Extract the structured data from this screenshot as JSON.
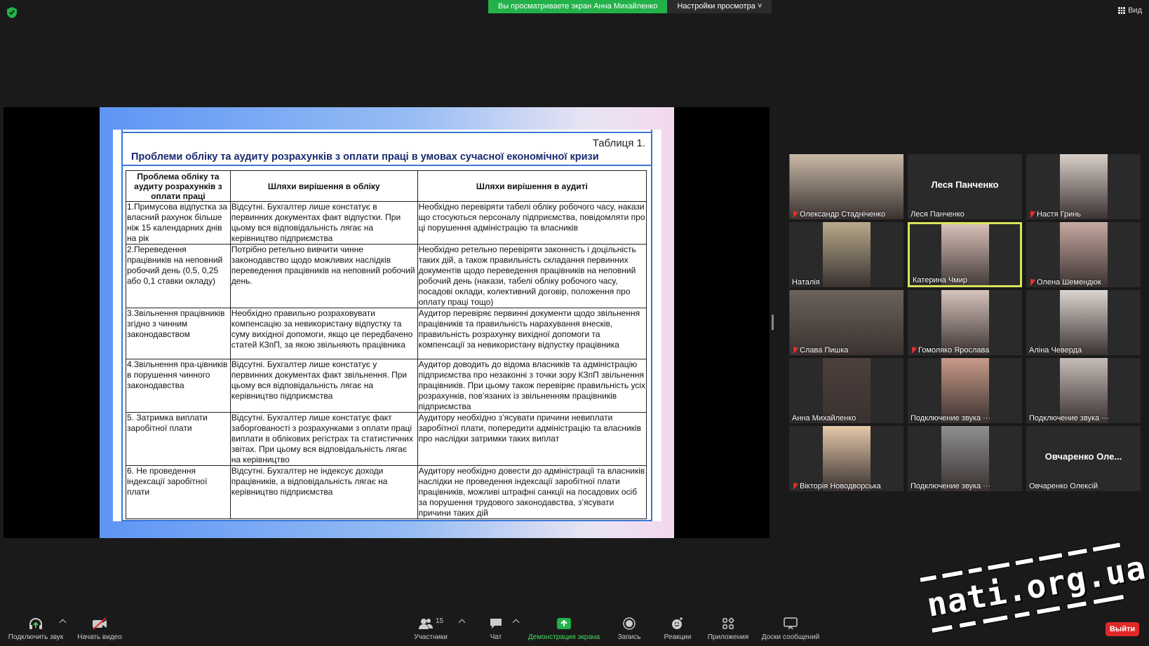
{
  "top_bar": {
    "banner_text": "Вы просматриваете экран Анна Михайленко",
    "settings_label": "Настройки просмотра",
    "view_label": "Вид"
  },
  "slide": {
    "table_number": "Таблиця 1.",
    "title": "Проблеми обліку та аудиту розрахунків з оплати праці в умовах сучасної економічної кризи",
    "headers": [
      "Проблема обліку та аудиту розрахунків з оплати праці",
      "Шляхи вирішення в обліку",
      "Шляхи вирішення в аудиті"
    ],
    "rows": [
      [
        "1.Примусова відпустка за власний рахунок більше ніж 15 календарних днів на рік",
        "Відсутні. Бухгалтер лише констатує в первинних документах факт відпустки. При цьому вся відповідальність лягає на керівництво підприємства",
        "Необхідно перевіряти табелі обліку робочого часу, накази що стосуються персоналу підприємства, повідомляти про ці порушення адміністрацію та власників"
      ],
      [
        "2.Переведення працівників на неповний робочий день (0,5, 0,25 або 0,1 ставки окладу)",
        "Потрібно ретельно вивчити чинне законодавство щодо можливих наслідків переведення працівників на неповний робочий день.",
        "Необхідно ретельно перевіряти законність і доцільність таких дій, а також правильність складання первинних документів щодо переведення працівників на неповний робочий день (накази, табелі обліку робочого часу, посадові оклади, колективний договір, положення про оплату праці тощо)"
      ],
      [
        "3.Звільнення працівників згідно з чинним законодавством",
        "Необхідно правильно розраховувати компенсацію за невикористану відпустку та суму вихідної допомоги, якщо це передбачено статей КЗпП, за якою звільняють працівника",
        "Аудитор перевіряє первинні документи щодо звільнення працівників та правильність нарахування внесків, правильність розрахунку вихідної допомоги та компенсації за невикористану відпустку працівника"
      ],
      [
        "4.Звільнення пра-цівників в порушення чинного законодавства",
        "Відсутні. Бухгалтер лише констатує у первинних документах факт звільнення. При цьому вся відповідальність лягає на керівництво підприємства",
        "Аудитор доводить до відома власників та адміністрацію підприємства про незаконні з точки зору КЗпП звільнення працівників. При цьому також перевіряє правильність усіх розрахунків, пов’язаних із звільненням працівників підприємства"
      ],
      [
        "5. Затримка виплати заробітної плати",
        "Відсутні. Бухгалтер лише констатує факт заборгованості з розрахунками з оплати праці виплати в облікових регістрах та статистичних звітах. При цьому вся відповідальність лягає на керівництво",
        "Аудитору необхідно з’ясувати причини невиплати заробітної плати, попередити адміністрацію та власників про наслідки затримки таких виплат"
      ],
      [
        "6. Не проведення індексації заробітної плати",
        "Відсутні. Бухгалтер не індексує доходи працівників, а відповідальність лягає на керівництво підприємства",
        "Аудитору необхідно довести до адміністрації та власників наслідки не проведення індексації заробітної плати працівників, можливі штрафні санкції на посадових осіб за порушення трудового законодавства, з’ясувати причини таких дій"
      ]
    ]
  },
  "participants": [
    {
      "name": "Олександр Стадніченко",
      "muted": true,
      "video": true,
      "photo_color": "#c9b9a8"
    },
    {
      "name": "Леся Панченко",
      "muted": false,
      "video": false,
      "big_name": "Леся Панченко"
    },
    {
      "name": "Настя Гринь",
      "muted": true,
      "video": true,
      "photo_color": "#d8cfc9"
    },
    {
      "name": "Наталія",
      "muted": false,
      "video": true,
      "photo_color": "#b7a98a"
    },
    {
      "name": "Катерина Чмир",
      "muted": false,
      "video": true,
      "active": true,
      "photo_color": "#d8c1b8"
    },
    {
      "name": "Олена Шемендюк",
      "muted": true,
      "video": true,
      "photo_color": "#c8a8a2"
    },
    {
      "name": "Слава Пишка",
      "muted": true,
      "video": true,
      "photo_color": "#6c625c"
    },
    {
      "name": "Гомоляко Ярослава",
      "muted": true,
      "video": true,
      "photo_color": "#d7c4bc"
    },
    {
      "name": "Аліна Чеверда",
      "muted": false,
      "video": true,
      "photo_color": "#ddd5cf"
    },
    {
      "name": "Анна Михайленко",
      "muted": false,
      "video": true,
      "photo_color": "#4d3f3c"
    },
    {
      "name": "Подключение звука ···",
      "muted": false,
      "video": true,
      "photo_color": "#c99a88"
    },
    {
      "name": "Подключение звука ···",
      "muted": false,
      "video": true,
      "photo_color": "#c6bdb8"
    },
    {
      "name": "Вікторія Новодворська",
      "muted": true,
      "video": true,
      "photo_color": "#e5c9a9"
    },
    {
      "name": "Подключение звука ···",
      "muted": false,
      "video": true,
      "photo_color": "#8f8f92"
    },
    {
      "name": "Овчаренко Олексій",
      "muted": false,
      "video": false,
      "big_name": "Овчаренко Оле..."
    }
  ],
  "toolbar": {
    "audio_label": "Подключить звук",
    "video_label": "Начать видео",
    "participants_label": "Участники",
    "participants_count": "15",
    "chat_label": "Чат",
    "share_label": "Демонстрация экрана",
    "record_label": "Запись",
    "reactions_label": "Реакции",
    "apps_label": "Приложения",
    "whiteboard_label": "Доски сообщений",
    "leave_label": "Выйти"
  },
  "watermark": "nati.org.ua",
  "colors": {
    "accent_green": "#23b24a",
    "active_speaker": "#d8e45a",
    "leave_red": "#e02828"
  }
}
